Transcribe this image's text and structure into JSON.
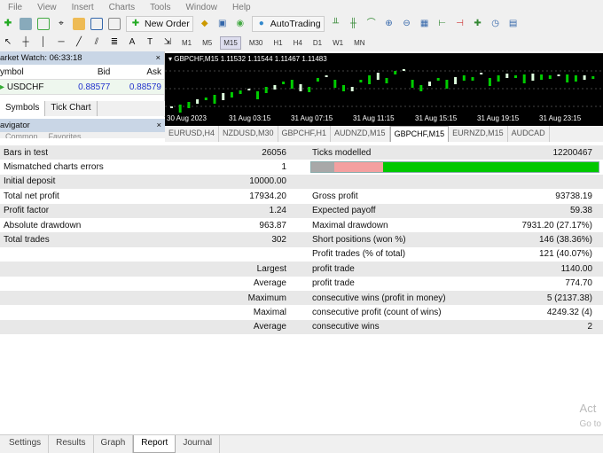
{
  "menu": [
    "File",
    "View",
    "Insert",
    "Charts",
    "Tools",
    "Window",
    "Help"
  ],
  "toolbar": {
    "new_order": "New Order",
    "autotrading": "AutoTrading",
    "timeframes": [
      "M1",
      "M5",
      "M15",
      "M30",
      "H1",
      "H4",
      "D1",
      "W1",
      "MN"
    ],
    "selected_tf": "M15"
  },
  "market_watch": {
    "title": "arket Watch: 06:33:18",
    "headers": [
      "ymbol",
      "Bid",
      "Ask"
    ],
    "rows": [
      {
        "symbol": "USDCHF",
        "bid": "0.88577",
        "ask": "0.88579"
      }
    ],
    "tabs": [
      "Symbols",
      "Tick Chart"
    ]
  },
  "navigator": {
    "title": "avigator",
    "tabs": [
      "Common",
      "Favorites"
    ]
  },
  "chart": {
    "header": "GBPCHF,M15  1.11532 1.11544 1.11467 1.11483",
    "xlabels": [
      "30 Aug 2023",
      "31 Aug 03:15",
      "31 Aug 07:15",
      "31 Aug 11:15",
      "31 Aug 15:15",
      "31 Aug 19:15",
      "31 Aug 23:15"
    ],
    "tabs": [
      "EURUSD,H4",
      "NZDUSD,M30",
      "GBPCHF,H1",
      "AUDNZD,M15",
      "GBPCHF,M15",
      "EURNZD,M15",
      "AUDCAD"
    ],
    "active_tab": "GBPCHF,M15"
  },
  "report": {
    "rows": [
      [
        "Bars in test",
        "26056",
        "Ticks modelled",
        "12200467"
      ],
      [
        "Mismatched charts errors",
        "1",
        "",
        ""
      ],
      [
        "Initial deposit",
        "10000.00",
        "",
        ""
      ],
      [
        "Total net profit",
        "17934.20",
        "Gross profit",
        "93738.19"
      ],
      [
        "Profit factor",
        "1.24",
        "Expected payoff",
        "59.38"
      ],
      [
        "Absolute drawdown",
        "963.87",
        "Maximal drawdown",
        "7931.20 (27.17%)"
      ],
      [
        "Total trades",
        "302",
        "Short positions (won %)",
        "146 (38.36%)"
      ],
      [
        "",
        "",
        "Profit trades (% of total)",
        "121 (40.07%)"
      ],
      [
        "",
        "Largest",
        "profit trade",
        "1140.00"
      ],
      [
        "",
        "Average",
        "profit trade",
        "774.70"
      ],
      [
        "",
        "Maximum",
        "consecutive wins (profit in money)",
        "5 (2137.38)"
      ],
      [
        "",
        "Maximal",
        "consecutive profit (count of wins)",
        "4249.32 (4)"
      ],
      [
        "",
        "Average",
        "consecutive wins",
        "2"
      ]
    ],
    "quality_bar": {
      "gray": 0.08,
      "pink": 0.17,
      "green": 0.75,
      "colors": [
        "#a8a8a8",
        "#f4a0a0",
        "#00c800"
      ]
    }
  },
  "bottom_tabs": [
    "Settings",
    "Results",
    "Graph",
    "Report",
    "Journal"
  ],
  "active_bottom_tab": "Report",
  "watermark": [
    "Act",
    "Go to"
  ]
}
